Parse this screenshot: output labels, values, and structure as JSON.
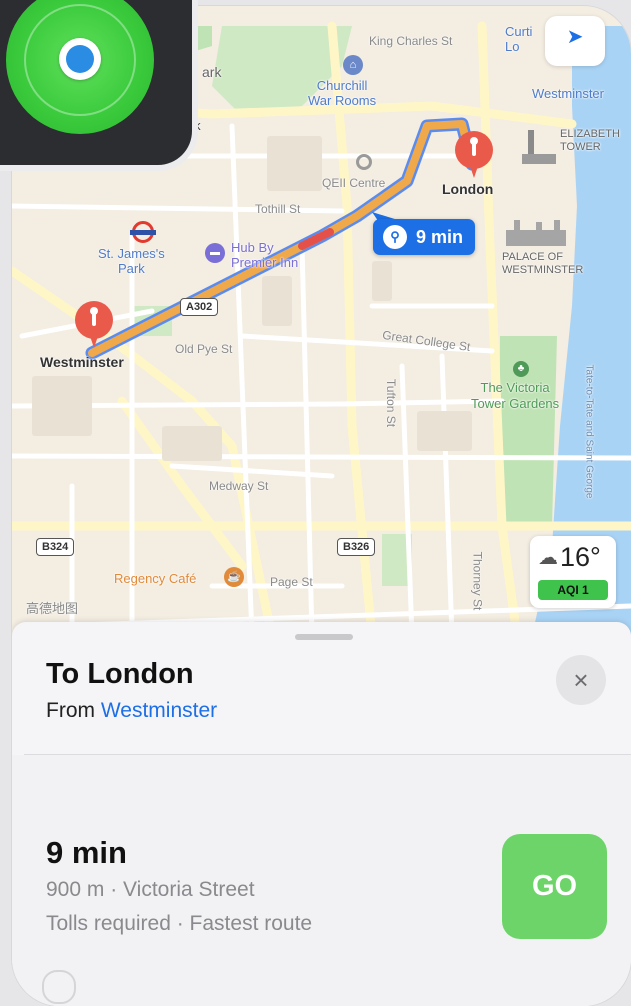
{
  "map": {
    "labels": {
      "king_charles_st": "King Charles St",
      "churchill_war_rooms": "Churchill\nWar Rooms",
      "westminster_top": "Westminster",
      "elizabeth_tower": "ELIZABETH\nTOWER",
      "park": "ark",
      "qeii_centre": "QEII Centre",
      "london": "London",
      "tothill_st": "Tothill St",
      "st_james_park": "St. James's\nPark",
      "hub_by_premier_inn": "Hub By\nPremier Inn",
      "palace_of_westminster": "PALACE OF\nWESTMINSTER",
      "westminster": "Westminster",
      "old_pye_st": "Old Pye St",
      "great_college_st": "Great College St",
      "tufton_st": "Tufton St",
      "victoria_tower_gardens": "The Victoria\nTower Gardens",
      "medway_st": "Medway St",
      "regency_cafe": "Regency Café",
      "page_st": "Page St",
      "thorney_st": "Thorney St",
      "amap": "高德地图",
      "curtis": "Curti\nLo",
      "walk": "alk",
      "tate": "Tate-to-Tate and Saint George"
    },
    "road_shields": {
      "a302": "A302",
      "b324": "B324",
      "b326": "B326"
    },
    "eta_chip": "9 min",
    "weather": {
      "temp": "16°",
      "aqi": "AQI 1"
    },
    "colors": {
      "route": "#f0a94a",
      "route_outline": "#5a8cf0",
      "traffic": "#e4504a",
      "pin": "#ea5a4a",
      "water": "#a9d3f5",
      "park": "#bfe3b4"
    }
  },
  "sheet": {
    "title": "To London",
    "from_prefix": "From",
    "from_place": "Westminster",
    "close_icon": "×",
    "route": {
      "time": "9 min",
      "detail": "900 m · Victoria Street",
      "note": "Tolls required · Fastest route",
      "go_label": "GO"
    },
    "colors": {
      "go": "#6dd46a",
      "link": "#1d6fe6"
    }
  }
}
